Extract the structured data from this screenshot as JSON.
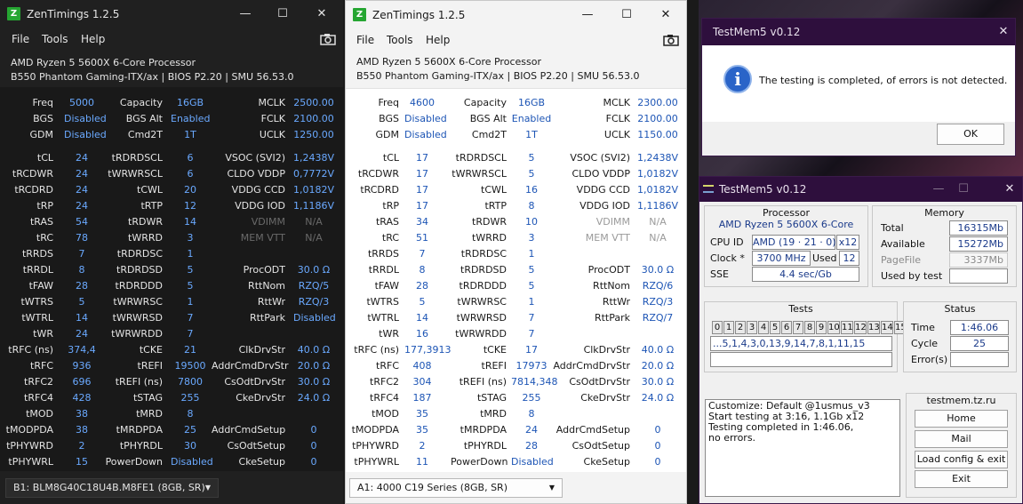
{
  "zt1": {
    "title": "ZenTimings 1.2.5",
    "menu": [
      "File",
      "Tools",
      "Help"
    ],
    "cpu": "AMD Ryzen 5 5600X 6-Core Processor",
    "board": "B550 Phantom Gaming-ITX/ax | BIOS P2.20 | SMU 56.53.0",
    "freq": {
      "Freq": "5000",
      "BGS": "Disabled",
      "GDM": "Disabled"
    },
    "cap": {
      "Capacity": "16GB",
      "BGS Alt": "Enabled",
      "Cmd2T": "1T"
    },
    "clk": {
      "MCLK": "2500.00",
      "FCLK": "2100.00",
      "UCLK": "1250.00"
    },
    "t1": [
      [
        "tCL",
        "24"
      ],
      [
        "tRCDWR",
        "24"
      ],
      [
        "tRCDRD",
        "24"
      ],
      [
        "tRP",
        "24"
      ],
      [
        "tRAS",
        "54"
      ],
      [
        "tRC",
        "78"
      ],
      [
        "tRRDS",
        "7"
      ],
      [
        "tRRDL",
        "8"
      ],
      [
        "tFAW",
        "28"
      ],
      [
        "tWTRS",
        "5"
      ],
      [
        "tWTRL",
        "14"
      ],
      [
        "tWR",
        "24"
      ],
      [
        "tRFC (ns)",
        "374,4"
      ],
      [
        "tRFC",
        "936"
      ],
      [
        "tRFC2",
        "696"
      ],
      [
        "tRFC4",
        "428"
      ],
      [
        "tMOD",
        "38"
      ],
      [
        "tMODPDA",
        "38"
      ],
      [
        "tPHYWRD",
        "2"
      ],
      [
        "tPHYWRL",
        "15"
      ]
    ],
    "t2": [
      [
        "tRDRDSCL",
        "6"
      ],
      [
        "tWRWRSCL",
        "6"
      ],
      [
        "tCWL",
        "20"
      ],
      [
        "tRTP",
        "12"
      ],
      [
        "tRDWR",
        "14"
      ],
      [
        "tWRRD",
        "3"
      ],
      [
        "tRDRDSC",
        "1"
      ],
      [
        "tRDRDSD",
        "5"
      ],
      [
        "tRDRDDD",
        "5"
      ],
      [
        "tWRWRSC",
        "1"
      ],
      [
        "tWRWRSD",
        "7"
      ],
      [
        "tWRWRDD",
        "7"
      ],
      [
        "tCKE",
        "21"
      ],
      [
        "tREFI",
        "19500"
      ],
      [
        "tREFI (ns)",
        "7800"
      ],
      [
        "tSTAG",
        "255"
      ],
      [
        "tMRD",
        "8"
      ],
      [
        "tMRDPDA",
        "25"
      ],
      [
        "tPHYRDL",
        "30"
      ],
      [
        "PowerDown",
        "Disabled"
      ]
    ],
    "t3": [
      [
        "VSOC (SVI2)",
        "1,2438V"
      ],
      [
        "CLDO VDDP",
        "0,7772V"
      ],
      [
        "VDDG CCD",
        "1,0182V"
      ],
      [
        "VDDG IOD",
        "1,1186V"
      ],
      [
        "VDIMM",
        "N/A"
      ],
      [
        "MEM VTT",
        "N/A"
      ],
      [
        "",
        ""
      ],
      [
        "ProcODT",
        "30.0 Ω"
      ],
      [
        "RttNom",
        "RZQ/5"
      ],
      [
        "RttWr",
        "RZQ/3"
      ],
      [
        "RttPark",
        "Disabled"
      ],
      [
        "",
        ""
      ],
      [
        "ClkDrvStr",
        "40.0 Ω"
      ],
      [
        "AddrCmdDrvStr",
        "20.0 Ω"
      ],
      [
        "CsOdtDrvStr",
        "30.0 Ω"
      ],
      [
        "CkeDrvStr",
        "24.0 Ω"
      ],
      [
        "",
        ""
      ],
      [
        "AddrCmdSetup",
        "0"
      ],
      [
        "CsOdtSetup",
        "0"
      ],
      [
        "CkeSetup",
        "0"
      ]
    ],
    "dimm": "B1: BLM8G40C18U4B.M8FE1 (8GB, SR)"
  },
  "zt2": {
    "title": "ZenTimings 1.2.5",
    "menu": [
      "File",
      "Tools",
      "Help"
    ],
    "cpu": "AMD Ryzen 5 5600X 6-Core Processor",
    "board": "B550 Phantom Gaming-ITX/ax | BIOS P2.20 | SMU 56.53.0",
    "freq": {
      "Freq": "4600",
      "BGS": "Disabled",
      "GDM": "Disabled"
    },
    "cap": {
      "Capacity": "16GB",
      "BGS Alt": "Enabled",
      "Cmd2T": "1T"
    },
    "clk": {
      "MCLK": "2300.00",
      "FCLK": "2100.00",
      "UCLK": "1150.00"
    },
    "t1": [
      [
        "tCL",
        "17"
      ],
      [
        "tRCDWR",
        "17"
      ],
      [
        "tRCDRD",
        "17"
      ],
      [
        "tRP",
        "17"
      ],
      [
        "tRAS",
        "34"
      ],
      [
        "tRC",
        "51"
      ],
      [
        "tRRDS",
        "7"
      ],
      [
        "tRRDL",
        "8"
      ],
      [
        "tFAW",
        "28"
      ],
      [
        "tWTRS",
        "5"
      ],
      [
        "tWTRL",
        "14"
      ],
      [
        "tWR",
        "16"
      ],
      [
        "tRFC (ns)",
        "177,3913"
      ],
      [
        "tRFC",
        "408"
      ],
      [
        "tRFC2",
        "304"
      ],
      [
        "tRFC4",
        "187"
      ],
      [
        "tMOD",
        "35"
      ],
      [
        "tMODPDA",
        "35"
      ],
      [
        "tPHYWRD",
        "2"
      ],
      [
        "tPHYWRL",
        "11"
      ]
    ],
    "t2": [
      [
        "tRDRDSCL",
        "5"
      ],
      [
        "tWRWRSCL",
        "5"
      ],
      [
        "tCWL",
        "16"
      ],
      [
        "tRTP",
        "8"
      ],
      [
        "tRDWR",
        "10"
      ],
      [
        "tWRRD",
        "3"
      ],
      [
        "tRDRDSC",
        "1"
      ],
      [
        "tRDRDSD",
        "5"
      ],
      [
        "tRDRDDD",
        "5"
      ],
      [
        "tWRWRSC",
        "1"
      ],
      [
        "tWRWRSD",
        "7"
      ],
      [
        "tWRWRDD",
        "7"
      ],
      [
        "tCKE",
        "17"
      ],
      [
        "tREFI",
        "17973"
      ],
      [
        "tREFI (ns)",
        "7814,348"
      ],
      [
        "tSTAG",
        "255"
      ],
      [
        "tMRD",
        "8"
      ],
      [
        "tMRDPDA",
        "24"
      ],
      [
        "tPHYRDL",
        "28"
      ],
      [
        "PowerDown",
        "Disabled"
      ]
    ],
    "t3": [
      [
        "VSOC (SVI2)",
        "1,2438V"
      ],
      [
        "CLDO VDDP",
        "1,0182V"
      ],
      [
        "VDDG CCD",
        "1,0182V"
      ],
      [
        "VDDG IOD",
        "1,1186V"
      ],
      [
        "VDIMM",
        "N/A"
      ],
      [
        "MEM VTT",
        "N/A"
      ],
      [
        "",
        ""
      ],
      [
        "ProcODT",
        "30.0 Ω"
      ],
      [
        "RttNom",
        "RZQ/6"
      ],
      [
        "RttWr",
        "RZQ/3"
      ],
      [
        "RttPark",
        "RZQ/7"
      ],
      [
        "",
        ""
      ],
      [
        "ClkDrvStr",
        "40.0 Ω"
      ],
      [
        "AddrCmdDrvStr",
        "20.0 Ω"
      ],
      [
        "CsOdtDrvStr",
        "30.0 Ω"
      ],
      [
        "CkeDrvStr",
        "24.0 Ω"
      ],
      [
        "",
        ""
      ],
      [
        "AddrCmdSetup",
        "0"
      ],
      [
        "CsOdtSetup",
        "0"
      ],
      [
        "CkeSetup",
        "0"
      ]
    ],
    "dimm": "A1: 4000 C19 Series (8GB, SR)"
  },
  "dialog": {
    "title": "TestMem5 v0.12",
    "message": "The testing is completed, of errors is not detected.",
    "ok": "OK"
  },
  "tm": {
    "title": "TestMem5 v0.12",
    "processor_title": "Processor",
    "cpu_name": "AMD Ryzen 5 5600X 6-Core",
    "cpuid_label": "CPU ID",
    "cpuid": "AMD  (19 · 21 · 0)",
    "threads": "x12",
    "clock_label": "Clock *",
    "clock": "3700 MHz",
    "used_label": "Used",
    "used": "12",
    "sse_label": "SSE",
    "sse": "4.4 sec/Gb",
    "memory_title": "Memory",
    "total_label": "Total",
    "total": "16315Mb",
    "available_label": "Available",
    "available": "15272Mb",
    "pagefile_label": "PageFile",
    "pagefile": "3337Mb",
    "usedbytest_label": "Used by test",
    "usedbytest": "",
    "tests_title": "Tests",
    "test_nums": [
      "0",
      "1",
      "2",
      "3",
      "4",
      "5",
      "6",
      "7",
      "8",
      "9",
      "10",
      "11",
      "12",
      "13",
      "14",
      "15"
    ],
    "sequence": "...5,1,4,3,0,13,9,14,7,8,1,11,15",
    "status_title": "Status",
    "time_label": "Time",
    "time": "1:46.06",
    "cycle_label": "Cycle",
    "cycle": "25",
    "errors_label": "Error(s)",
    "errors": "",
    "log": [
      "Customize: Default @1usmus_v3",
      "Start testing at 3:16, 1.1Gb x12",
      "Testing completed in 1:46.06,",
      "no errors."
    ],
    "site": "testmem.tz.ru",
    "buttons": [
      "Home",
      "Mail",
      "Load config & exit",
      "Exit"
    ]
  }
}
